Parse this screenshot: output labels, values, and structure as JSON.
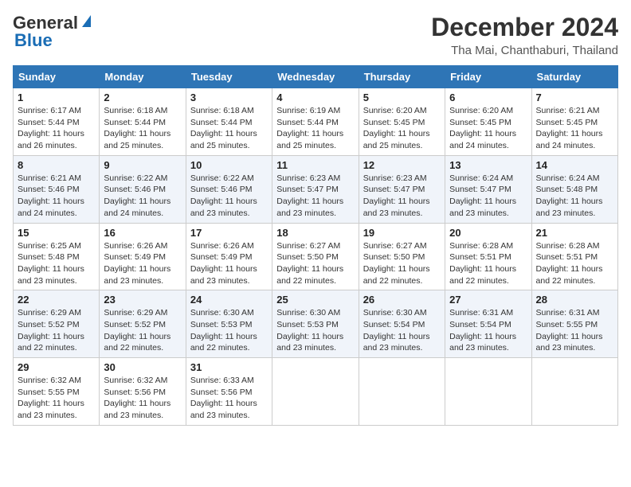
{
  "header": {
    "logo_line1": "General",
    "logo_line2": "Blue",
    "title": "December 2024",
    "subtitle": "Tha Mai, Chanthaburi, Thailand"
  },
  "days_of_week": [
    "Sunday",
    "Monday",
    "Tuesday",
    "Wednesday",
    "Thursday",
    "Friday",
    "Saturday"
  ],
  "weeks": [
    [
      {
        "day": "1",
        "sunrise": "6:17 AM",
        "sunset": "5:44 PM",
        "daylight": "11 hours and 26 minutes."
      },
      {
        "day": "2",
        "sunrise": "6:18 AM",
        "sunset": "5:44 PM",
        "daylight": "11 hours and 25 minutes."
      },
      {
        "day": "3",
        "sunrise": "6:18 AM",
        "sunset": "5:44 PM",
        "daylight": "11 hours and 25 minutes."
      },
      {
        "day": "4",
        "sunrise": "6:19 AM",
        "sunset": "5:44 PM",
        "daylight": "11 hours and 25 minutes."
      },
      {
        "day": "5",
        "sunrise": "6:20 AM",
        "sunset": "5:45 PM",
        "daylight": "11 hours and 25 minutes."
      },
      {
        "day": "6",
        "sunrise": "6:20 AM",
        "sunset": "5:45 PM",
        "daylight": "11 hours and 24 minutes."
      },
      {
        "day": "7",
        "sunrise": "6:21 AM",
        "sunset": "5:45 PM",
        "daylight": "11 hours and 24 minutes."
      }
    ],
    [
      {
        "day": "8",
        "sunrise": "6:21 AM",
        "sunset": "5:46 PM",
        "daylight": "11 hours and 24 minutes."
      },
      {
        "day": "9",
        "sunrise": "6:22 AM",
        "sunset": "5:46 PM",
        "daylight": "11 hours and 24 minutes."
      },
      {
        "day": "10",
        "sunrise": "6:22 AM",
        "sunset": "5:46 PM",
        "daylight": "11 hours and 23 minutes."
      },
      {
        "day": "11",
        "sunrise": "6:23 AM",
        "sunset": "5:47 PM",
        "daylight": "11 hours and 23 minutes."
      },
      {
        "day": "12",
        "sunrise": "6:23 AM",
        "sunset": "5:47 PM",
        "daylight": "11 hours and 23 minutes."
      },
      {
        "day": "13",
        "sunrise": "6:24 AM",
        "sunset": "5:47 PM",
        "daylight": "11 hours and 23 minutes."
      },
      {
        "day": "14",
        "sunrise": "6:24 AM",
        "sunset": "5:48 PM",
        "daylight": "11 hours and 23 minutes."
      }
    ],
    [
      {
        "day": "15",
        "sunrise": "6:25 AM",
        "sunset": "5:48 PM",
        "daylight": "11 hours and 23 minutes."
      },
      {
        "day": "16",
        "sunrise": "6:26 AM",
        "sunset": "5:49 PM",
        "daylight": "11 hours and 23 minutes."
      },
      {
        "day": "17",
        "sunrise": "6:26 AM",
        "sunset": "5:49 PM",
        "daylight": "11 hours and 23 minutes."
      },
      {
        "day": "18",
        "sunrise": "6:27 AM",
        "sunset": "5:50 PM",
        "daylight": "11 hours and 22 minutes."
      },
      {
        "day": "19",
        "sunrise": "6:27 AM",
        "sunset": "5:50 PM",
        "daylight": "11 hours and 22 minutes."
      },
      {
        "day": "20",
        "sunrise": "6:28 AM",
        "sunset": "5:51 PM",
        "daylight": "11 hours and 22 minutes."
      },
      {
        "day": "21",
        "sunrise": "6:28 AM",
        "sunset": "5:51 PM",
        "daylight": "11 hours and 22 minutes."
      }
    ],
    [
      {
        "day": "22",
        "sunrise": "6:29 AM",
        "sunset": "5:52 PM",
        "daylight": "11 hours and 22 minutes."
      },
      {
        "day": "23",
        "sunrise": "6:29 AM",
        "sunset": "5:52 PM",
        "daylight": "11 hours and 22 minutes."
      },
      {
        "day": "24",
        "sunrise": "6:30 AM",
        "sunset": "5:53 PM",
        "daylight": "11 hours and 22 minutes."
      },
      {
        "day": "25",
        "sunrise": "6:30 AM",
        "sunset": "5:53 PM",
        "daylight": "11 hours and 23 minutes."
      },
      {
        "day": "26",
        "sunrise": "6:30 AM",
        "sunset": "5:54 PM",
        "daylight": "11 hours and 23 minutes."
      },
      {
        "day": "27",
        "sunrise": "6:31 AM",
        "sunset": "5:54 PM",
        "daylight": "11 hours and 23 minutes."
      },
      {
        "day": "28",
        "sunrise": "6:31 AM",
        "sunset": "5:55 PM",
        "daylight": "11 hours and 23 minutes."
      }
    ],
    [
      {
        "day": "29",
        "sunrise": "6:32 AM",
        "sunset": "5:55 PM",
        "daylight": "11 hours and 23 minutes."
      },
      {
        "day": "30",
        "sunrise": "6:32 AM",
        "sunset": "5:56 PM",
        "daylight": "11 hours and 23 minutes."
      },
      {
        "day": "31",
        "sunrise": "6:33 AM",
        "sunset": "5:56 PM",
        "daylight": "11 hours and 23 minutes."
      },
      null,
      null,
      null,
      null
    ]
  ]
}
